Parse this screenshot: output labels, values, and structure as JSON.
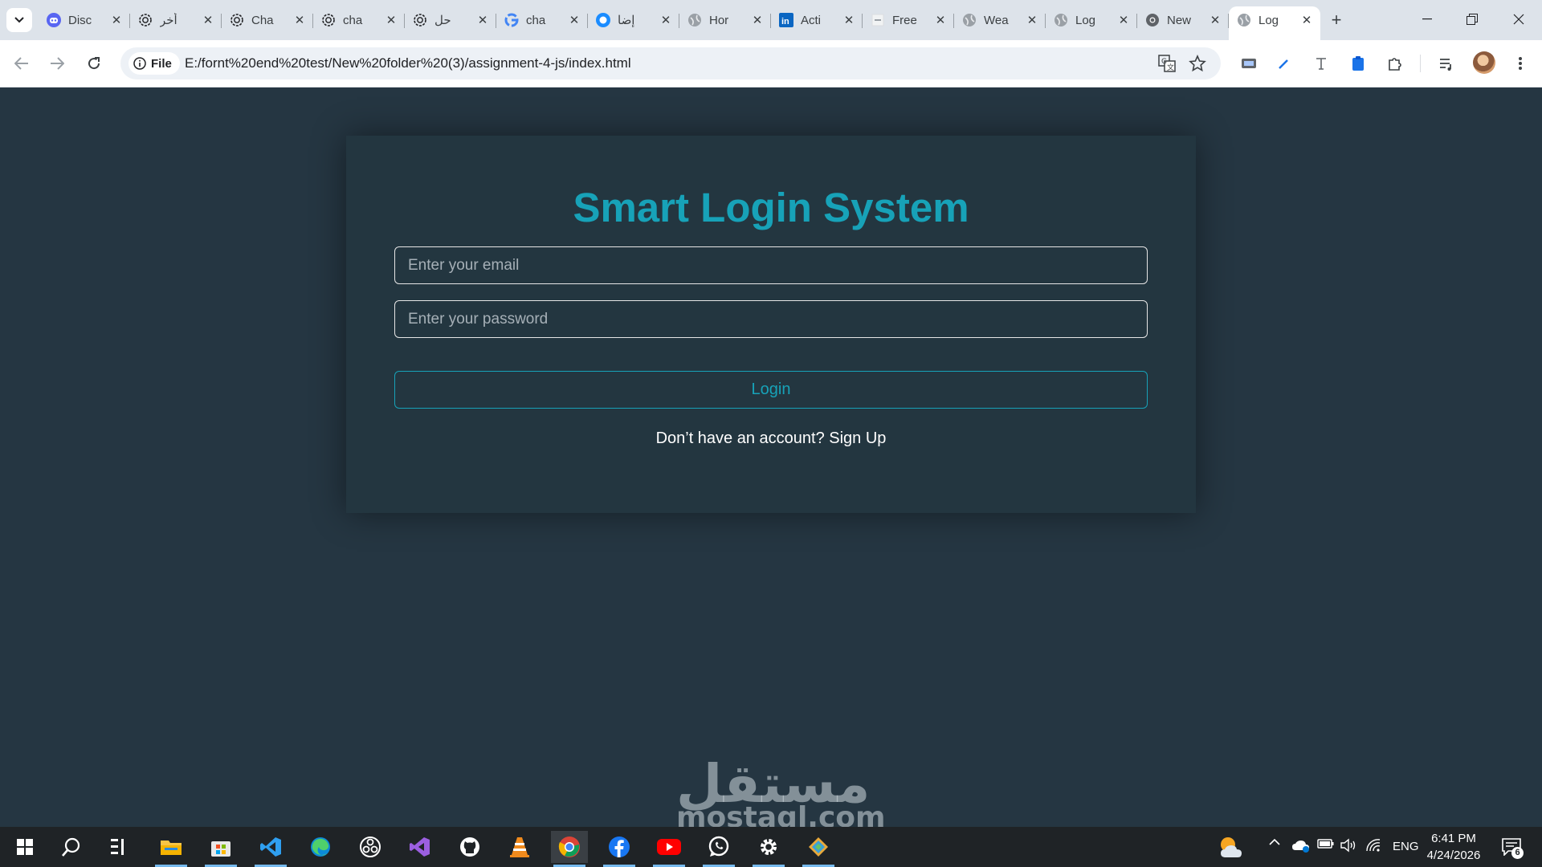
{
  "browser": {
    "tabs": [
      {
        "label": "Disc",
        "icon": "discord-icon",
        "color": "#5865f2"
      },
      {
        "label": "أخر",
        "icon": "chatgpt-icon",
        "color": "#202124"
      },
      {
        "label": "Cha",
        "icon": "chatgpt-icon",
        "color": "#202124"
      },
      {
        "label": "cha",
        "icon": "chatgpt-icon",
        "color": "#202124"
      },
      {
        "label": "حل",
        "icon": "chatgpt-icon",
        "color": "#202124"
      },
      {
        "label": "cha",
        "icon": "google-icon",
        "color": "#4285f4"
      },
      {
        "label": "إضا",
        "icon": "circle-app-icon",
        "color": "#1a8cff"
      },
      {
        "label": "Hor",
        "icon": "globe-icon",
        "color": "#5f6368"
      },
      {
        "label": "Acti",
        "icon": "linkedin-icon",
        "color": "#0a66c2"
      },
      {
        "label": "Free",
        "icon": "page-icon",
        "color": "#5f6368"
      },
      {
        "label": "Wea",
        "icon": "globe-icon",
        "color": "#5f6368"
      },
      {
        "label": "Log",
        "icon": "globe-icon",
        "color": "#5f6368"
      },
      {
        "label": "New",
        "icon": "chrome-icon",
        "color": "#5f6368"
      },
      {
        "label": "Log",
        "icon": "globe-icon",
        "color": "#5f6368",
        "active": true
      }
    ],
    "site_chip": "File",
    "url": "E:/fornt%20end%20test/New%20folder%20(3)/assignment-4-js/index.html"
  },
  "login": {
    "title": "Smart Login System",
    "email_placeholder": "Enter your email",
    "password_placeholder": "Enter your password",
    "login_label": "Login",
    "signup_text": "Don’t have an account? Sign Up"
  },
  "watermark": {
    "arabic": "مستقل",
    "latin": "mostaql.com"
  },
  "taskbar": {
    "language": "ENG",
    "time": "6:41 PM",
    "date": "4/24/2026",
    "notification_count": "6"
  },
  "colors": {
    "accent": "#17a2b8",
    "page_background": "#253642",
    "card_background": "#233640"
  }
}
